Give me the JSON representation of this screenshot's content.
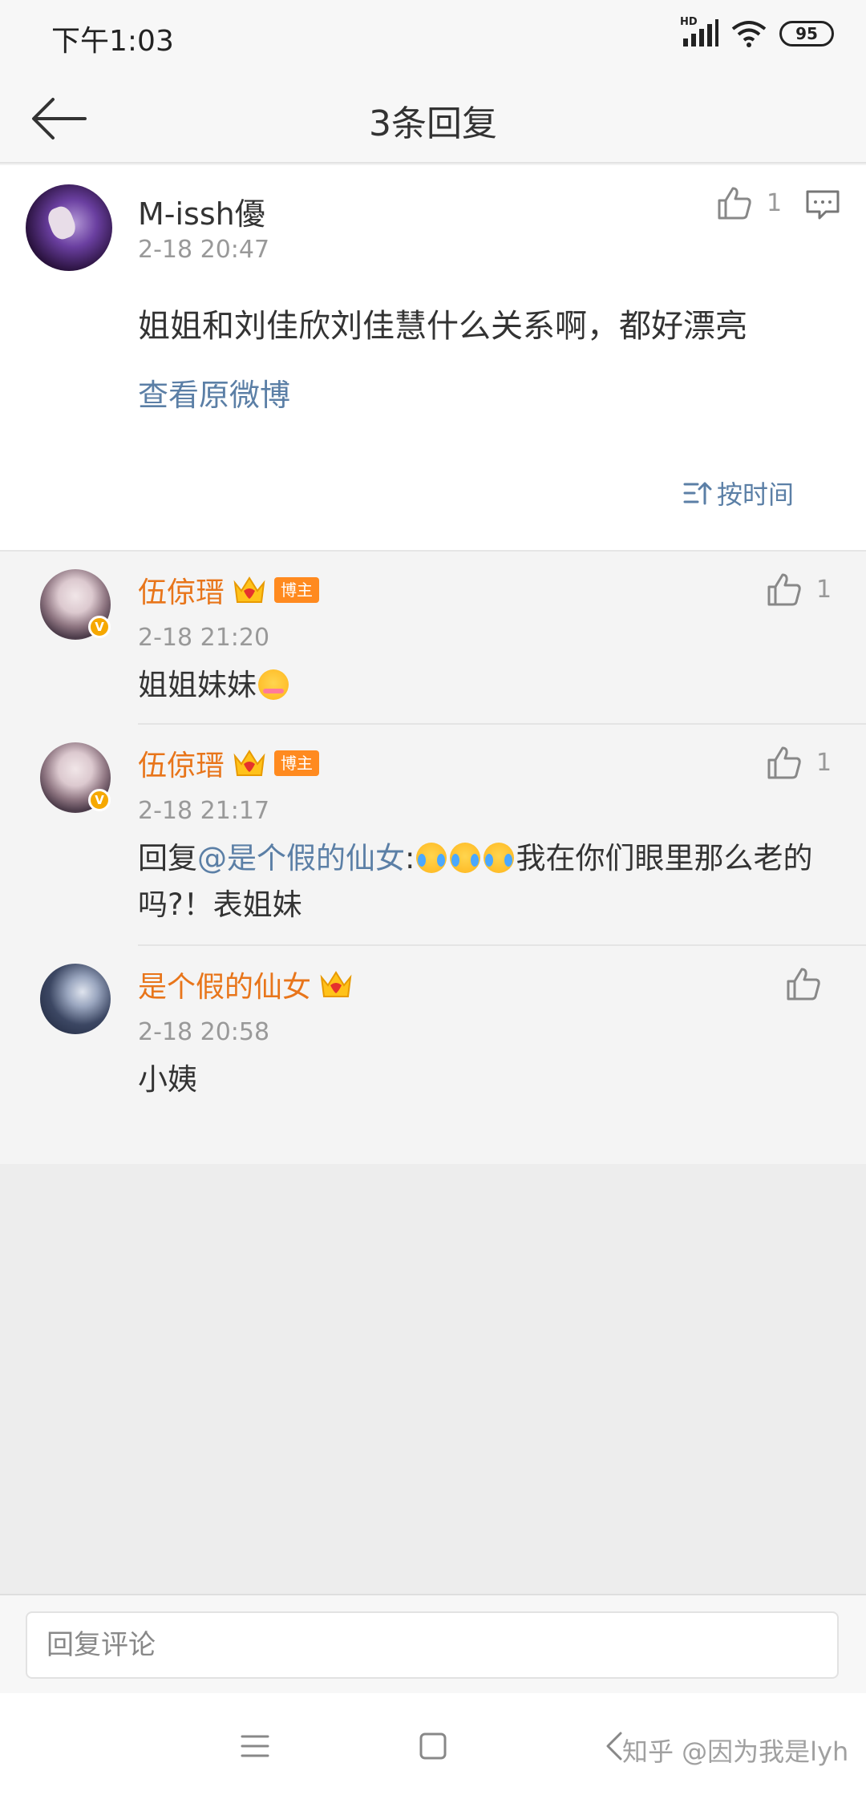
{
  "status_bar": {
    "time": "下午1:03",
    "network": "HD",
    "battery": "95"
  },
  "header": {
    "title": "3条回复"
  },
  "main_comment": {
    "username": "M-issh優",
    "time": "2-18 20:47",
    "likes": "1",
    "text": "姐姐和刘佳欣刘佳慧什么关系啊，都好漂亮",
    "view_original": "查看原微博",
    "sort_label": "按时间"
  },
  "replies": [
    {
      "username": "伍倞瑨",
      "badge": "博主",
      "time": "2-18 21:20",
      "likes": "1",
      "text": "姐姐妹妹"
    },
    {
      "username": "伍倞瑨",
      "badge": "博主",
      "time": "2-18 21:17",
      "likes": "1",
      "prefix": "回复",
      "mention": "@是个假的仙女",
      "colon": ":",
      "text": "我在你们眼里那么老的吗?！表姐妹"
    },
    {
      "username": "是个假的仙女",
      "time": "2-18 20:58",
      "text": "小姨"
    }
  ],
  "input": {
    "placeholder": "回复评论"
  },
  "watermark": "知乎 @因为我是lyh",
  "colors": {
    "accent_link": "#5b7fa6",
    "username_orange": "#e8751a",
    "badge_orange": "#ff8a1f"
  }
}
